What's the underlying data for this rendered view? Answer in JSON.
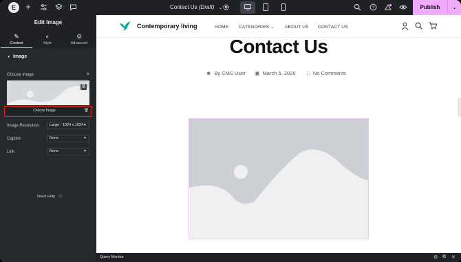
{
  "topbar": {
    "logo": "E",
    "doc_title": "Contact Us",
    "doc_status": "(Draft)",
    "publish_label": "Publish",
    "icons": [
      "elementor-logo",
      "add-icon",
      "settings-sliders-icon",
      "layers-icon",
      "comments-icon",
      "chevron-down-icon",
      "gear-icon",
      "desktop-icon",
      "tablet-icon",
      "mobile-icon",
      "search-icon",
      "help-icon",
      "notifications-icon",
      "preview-eye-icon"
    ]
  },
  "panel": {
    "title": "Edit Image",
    "tabs": [
      {
        "label": "Content",
        "icon": "pencil-icon",
        "active": true
      },
      {
        "label": "Style",
        "icon": "half-circle-icon",
        "active": false
      },
      {
        "label": "Advanced",
        "icon": "gear-icon",
        "active": false
      }
    ],
    "section_title": "Image",
    "choose_image_label": "Choose Image",
    "choose_image_button": "Choose Image",
    "resolution_label": "Image Resolution",
    "resolution_value": "Large - 1024 x 1024",
    "caption_label": "Caption",
    "caption_value": "None",
    "link_label": "Link",
    "link_value": "None",
    "help_label": "Need Help"
  },
  "site": {
    "name": "Contemporary living",
    "nav": [
      "HOME",
      "CATEGORIES",
      "ABOUT US",
      "CONTACT US"
    ],
    "page_title": "Contact Us",
    "meta": {
      "author": "By CMS User",
      "date": "March 5, 2026",
      "comments": "No Comments"
    },
    "accent_color": "#1aa39a"
  },
  "bottombar": {
    "label": "Query Monitor"
  }
}
